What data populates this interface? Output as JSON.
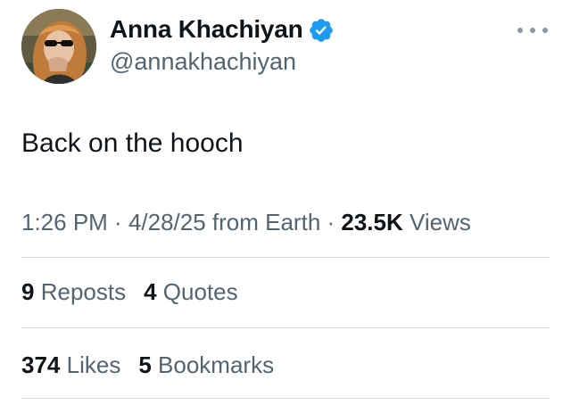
{
  "author": {
    "display_name": "Anna Khachiyan",
    "handle": "@annakhachiyan",
    "verified": true,
    "verified_color": "#1d9bf0"
  },
  "tweet": {
    "text": "Back on the hooch"
  },
  "meta": {
    "time": "1:26 PM",
    "separator1": " · ",
    "date": "4/28/25",
    "source": " from Earth",
    "separator2": " · ",
    "views_count": "23.5K",
    "views_label": " Views"
  },
  "stats": {
    "reposts_count": "9",
    "reposts_label": "Reposts",
    "quotes_count": "4",
    "quotes_label": "Quotes",
    "likes_count": "374",
    "likes_label": "Likes",
    "bookmarks_count": "5",
    "bookmarks_label": "Bookmarks"
  },
  "icons": {
    "more": "more-horizontal-icon",
    "verified": "verified-badge-icon"
  }
}
